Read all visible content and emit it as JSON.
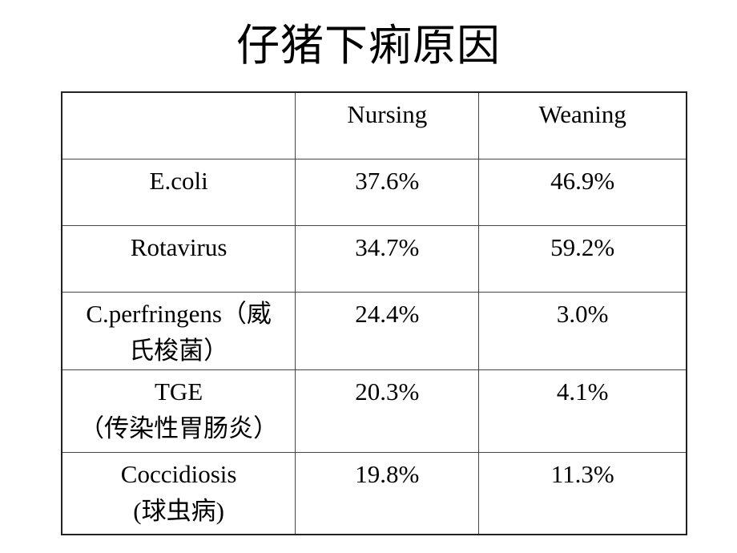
{
  "slide": {
    "title": "仔猪下痢原因"
  },
  "table": {
    "headers": [
      "",
      "Nursing",
      "Weaning"
    ],
    "rows": [
      {
        "cause_lines": [
          "E.coli"
        ],
        "nursing": "37.6%",
        "weaning": "46.9%"
      },
      {
        "cause_lines": [
          "Rotavirus"
        ],
        "nursing": "34.7%",
        "weaning": "59.2%"
      },
      {
        "cause_lines": [
          "C.perfringens（威",
          "氏梭菌）"
        ],
        "nursing": "24.4%",
        "weaning": "3.0%"
      },
      {
        "cause_lines": [
          "TGE",
          "（传染性胃肠炎）"
        ],
        "nursing": "20.3%",
        "weaning": "4.1%"
      },
      {
        "cause_lines": [
          "Coccidiosis",
          "(球虫病)"
        ],
        "nursing": "19.8%",
        "weaning": "11.3%"
      }
    ]
  }
}
